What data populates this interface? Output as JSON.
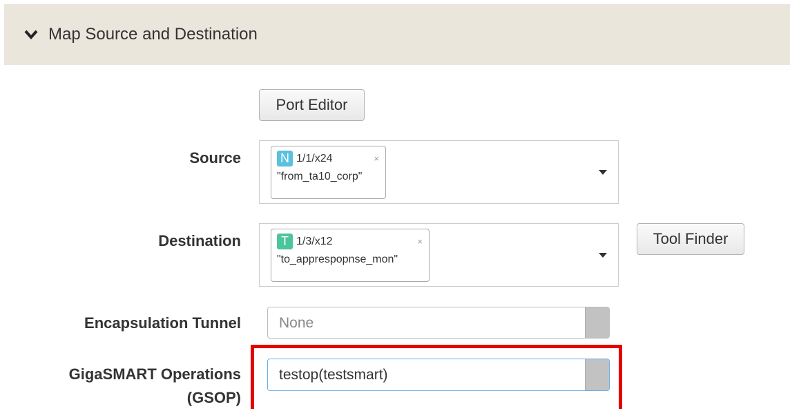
{
  "section": {
    "title": "Map Source and Destination"
  },
  "buttons": {
    "port_editor": "Port Editor",
    "tool_finder": "Tool Finder"
  },
  "labels": {
    "source": "Source",
    "destination": "Destination",
    "encapsulation": "Encapsulation Tunnel",
    "gsop_line1": "GigaSMART Operations",
    "gsop_line2": "(GSOP)"
  },
  "source": {
    "badge": "N",
    "badge_color": "#5bc0de",
    "port": "1/1/x24",
    "alias": "\"from_ta10_corp\"",
    "remove": "×"
  },
  "destination": {
    "badge": "T",
    "badge_color": "#4cc59b",
    "port": "1/3/x12",
    "alias": "\"to_apprespopnse_mon\"",
    "remove": "×"
  },
  "encapsulation": {
    "placeholder": "None"
  },
  "gsop": {
    "value": "testop(testsmart)"
  },
  "colors": {
    "header_bg": "#ebe6dc",
    "highlight": "#e60000"
  }
}
